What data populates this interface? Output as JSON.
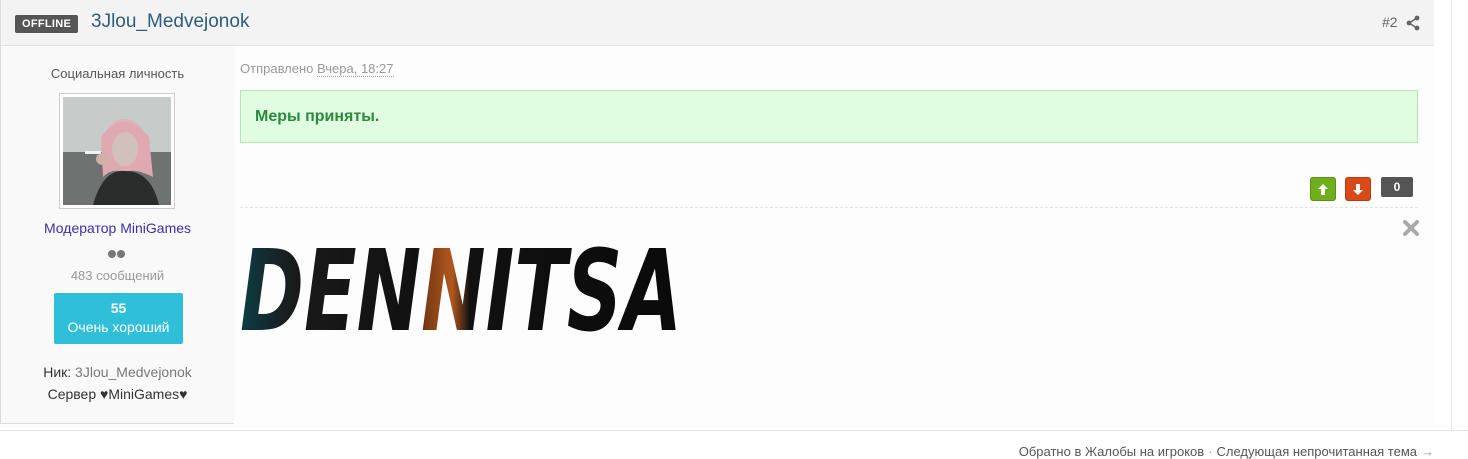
{
  "post": {
    "status_badge": "OFFLINE",
    "author_name": "3Jlou_Medvejonok",
    "post_number": "#2",
    "icons": {
      "share": "share-icon",
      "close": "close-icon",
      "vote_up": "arrow-up-icon",
      "vote_down": "arrow-down-icon"
    }
  },
  "author": {
    "title": "Социальная личность",
    "group": "Модератор MiniGames",
    "posts_count": "483 сообщений",
    "reputation_value": "55",
    "reputation_label": "Очень хороший",
    "nick_label": "Ник:",
    "nick_value": "3Jlou_Medvejonok",
    "server_line": "Сервер ♥MiniGames♥"
  },
  "content": {
    "sent_label": "Отправлено",
    "sent_date": "Вчера, 18:27",
    "message": "Меры приняты.",
    "vote_count": "0",
    "signature_text": "DENNITSA"
  },
  "footer": {
    "back_link": "Обратно в Жалобы на игроков",
    "separator": "·",
    "next_link": "Следующая непрочитанная тема",
    "arrow": "→"
  },
  "colors": {
    "accent_link": "#2d5d7e",
    "group_color": "#3a2fa8",
    "reputation_bg": "#2fbfd9",
    "message_bg": "#e0fce1",
    "message_text": "#2c8a3e",
    "vote_up": "#6fae1c",
    "vote_down": "#d84a17"
  }
}
